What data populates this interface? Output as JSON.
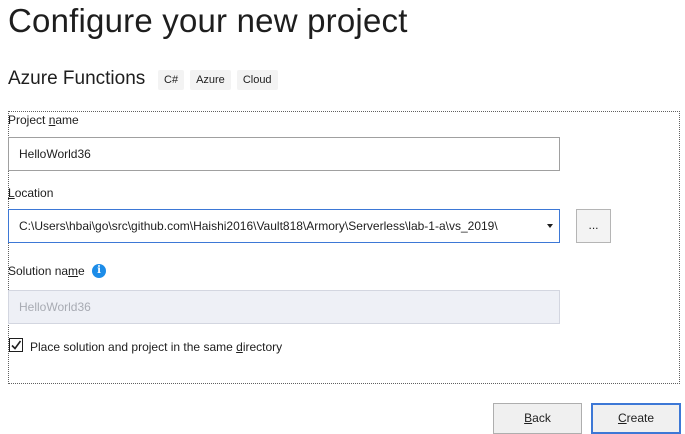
{
  "page": {
    "title": "Configure your new project"
  },
  "template": {
    "name": "Azure Functions",
    "tags": [
      "C#",
      "Azure",
      "Cloud"
    ]
  },
  "form": {
    "project_name": {
      "label_prefix": "Project ",
      "label_mnemonic": "n",
      "label_suffix": "ame",
      "value": "HelloWorld36"
    },
    "location": {
      "label_mnemonic": "L",
      "label_suffix": "ocation",
      "value": "C:\\Users\\hbai\\go\\src\\github.com\\Haishi2016\\Vault818\\Armory\\Serverless\\lab-1-a\\vs_2019\\",
      "browse_label": "..."
    },
    "solution_name": {
      "label_prefix": "Solution na",
      "label_mnemonic": "m",
      "label_suffix": "e",
      "value": "HelloWorld36",
      "info_icon": "info-icon"
    },
    "same_directory": {
      "label_prefix": "Place solution and project in the same ",
      "label_mnemonic": "d",
      "label_suffix": "irectory",
      "checked": true
    }
  },
  "footer": {
    "back": {
      "mnemonic": "B",
      "rest": "ack"
    },
    "create": {
      "mnemonic": "C",
      "rest": "reate"
    }
  },
  "colors": {
    "accent": "#3d78d6",
    "info": "#1c8ce8",
    "disabled_bg": "#eef0f6"
  }
}
